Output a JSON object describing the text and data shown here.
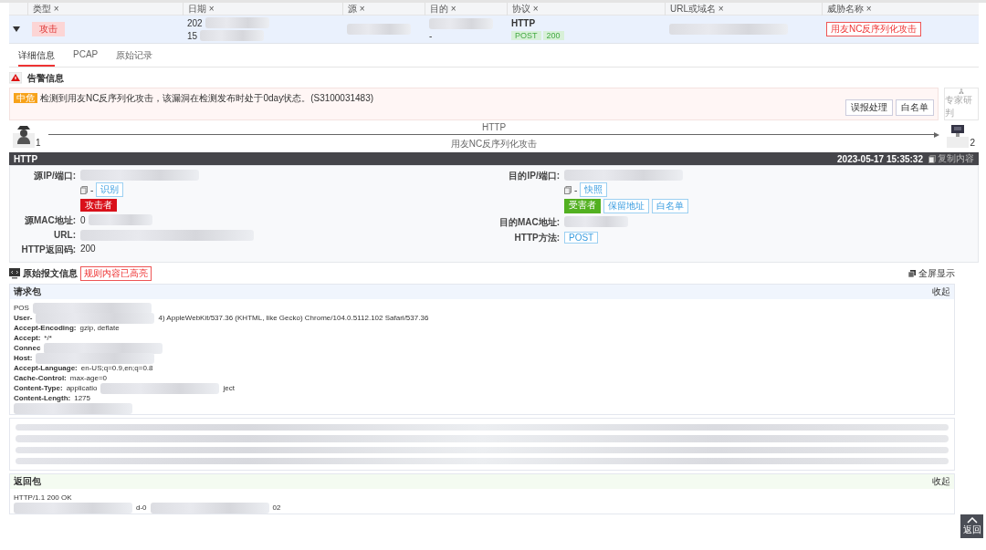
{
  "table": {
    "columns": [
      {
        "label": "类型",
        "close": "×"
      },
      {
        "label": "日期",
        "close": "×"
      },
      {
        "label": "源",
        "close": "×"
      },
      {
        "label": "目的",
        "close": "×"
      },
      {
        "label": "协议",
        "close": "×"
      },
      {
        "label": "URL或域名",
        "close": "×"
      },
      {
        "label": "威胁名称",
        "close": "×"
      }
    ],
    "row": {
      "expanded": true,
      "type_tag": "攻击",
      "date_lines": [
        "202",
        "15"
      ],
      "destination_suffix": "-",
      "protocol": "HTTP",
      "method": "POST",
      "status": "200",
      "threat_name": "用友NC反序列化攻击"
    }
  },
  "tabs": [
    {
      "label": "详细信息",
      "selected": true
    },
    {
      "label": "PCAP",
      "selected": false
    },
    {
      "label": "原始记录",
      "selected": false
    }
  ],
  "alert": {
    "title": "告警信息",
    "severity": "中危",
    "message": "检测到用友NC反序列化攻击，该漏洞在检测发布时处于0day状态。(S3100031483)",
    "buttons": [
      "误报处理",
      "白名单"
    ],
    "expert_label": "专家研判"
  },
  "flow": {
    "source_label": "1",
    "protocol": "HTTP",
    "attack": "用友NC反序列化攻击",
    "target_label": "2"
  },
  "http_panel": {
    "title": "HTTP",
    "timestamp": "2023-05-17 15:35:32",
    "copy_label": "复制内容",
    "left": [
      {
        "kind": "ip",
        "label": "源IP/端口:",
        "port": "-",
        "link": "识别",
        "tags": [
          {
            "text": "攻击者",
            "kind": "attacker"
          }
        ]
      },
      {
        "kind": "redacted",
        "label": "源MAC地址:",
        "prefix": "0"
      },
      {
        "kind": "redacted",
        "label": "URL:"
      },
      {
        "kind": "text",
        "label": "HTTP返回码:",
        "value": "200"
      }
    ],
    "right": [
      {
        "kind": "ip",
        "label": "目的IP/端口:",
        "port": "-",
        "link": "快照",
        "tags": [
          {
            "text": "受害者",
            "kind": "victim"
          },
          {
            "text": "保留地址",
            "kind": "label"
          },
          {
            "text": "白名单",
            "kind": "label"
          }
        ]
      },
      {
        "kind": "redacted",
        "label": "目的MAC地址:"
      },
      {
        "kind": "tag",
        "label": "HTTP方法:",
        "value": "POST"
      }
    ]
  },
  "raw": {
    "title": "原始报文信息",
    "badge": "规则内容已高亮",
    "fullscreen": "全屏显示",
    "request": {
      "title": "请求包",
      "collapse": "收起",
      "lines": [
        [
          {
            "kind": "text",
            "text": "POS"
          },
          {
            "kind": "redacted"
          }
        ],
        [
          {
            "kind": "key",
            "text": "User-"
          },
          {
            "kind": "redacted"
          },
          {
            "kind": "text",
            "text": "4) AppleWebKit/537.36 (KHTML, like Gecko) Chrome/104.0.5112.102 Safari/537.36"
          }
        ],
        [
          {
            "kind": "key",
            "text": "Accept-Encoding:"
          },
          {
            "kind": "text",
            "text": "gzip, deflate"
          }
        ],
        [
          {
            "kind": "key",
            "text": "Accept:"
          },
          {
            "kind": "text",
            "text": "*/*"
          }
        ],
        [
          {
            "kind": "key",
            "text": "Connec"
          },
          {
            "kind": "redacted"
          }
        ],
        [
          {
            "kind": "key",
            "text": "Host:"
          },
          {
            "kind": "redacted"
          }
        ],
        [
          {
            "kind": "key",
            "text": "Accept-Language:"
          },
          {
            "kind": "text",
            "text": "en-US;q=0.9,en;q=0.8"
          }
        ],
        [
          {
            "kind": "key",
            "text": "Cache-Control:"
          },
          {
            "kind": "text",
            "text": "max-age=0"
          }
        ],
        [
          {
            "kind": "key",
            "text": "Content-Type:"
          },
          {
            "kind": "text",
            "text": "applicatio"
          },
          {
            "kind": "redacted"
          },
          {
            "kind": "text",
            "text": "ject"
          }
        ],
        [
          {
            "kind": "key",
            "text": "Content-Length:"
          },
          {
            "kind": "text",
            "text": "1275"
          }
        ],
        [
          {
            "kind": "redacted"
          }
        ]
      ]
    },
    "response": {
      "title": "返回包",
      "collapse": "收起",
      "lines": [
        [
          {
            "kind": "text",
            "text": "HTTP/1.1 200 OK"
          }
        ],
        [
          {
            "kind": "redacted"
          },
          {
            "kind": "text",
            "text": "d-0"
          },
          {
            "kind": "redacted"
          },
          {
            "kind": "text",
            "text": "02"
          }
        ]
      ]
    }
  },
  "back_to_top": "返回"
}
